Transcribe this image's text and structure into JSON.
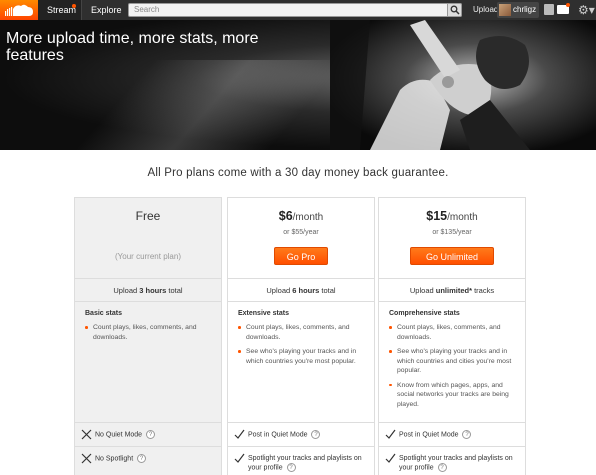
{
  "topbar": {
    "tabs": [
      {
        "label": "Stream"
      },
      {
        "label": "Explore"
      }
    ],
    "search_placeholder": "Search",
    "upload_label": "Upload",
    "username": "chrligz"
  },
  "hero": {
    "title": "More upload time, more stats, more features"
  },
  "guarantee": "All Pro plans come with a 30 day money back guarantee.",
  "plans": {
    "free": {
      "name": "Free",
      "current": "(Your current plan)",
      "upload_prefix": "Upload ",
      "upload_amount": "3 hours",
      "upload_suffix": " total",
      "stats_title": "Basic stats",
      "stats": [
        "Count plays, likes, comments, and downloads."
      ],
      "quiet": "No Quiet Mode",
      "spotlight": "No Spotlight"
    },
    "pro": {
      "price": "$6",
      "period": "/month",
      "yearly": "or $55/year",
      "button": "Go Pro",
      "upload_prefix": "Upload ",
      "upload_amount": "6 hours",
      "upload_suffix": " total",
      "stats_title": "Extensive stats",
      "stats": [
        "Count plays, likes, comments, and downloads.",
        "See who's playing your tracks and in which countries you're most popular."
      ],
      "quiet": "Post in Quiet Mode",
      "spotlight": "Spotlight your tracks and playlists on your profile"
    },
    "unlimited": {
      "price": "$15",
      "period": "/month",
      "yearly": "or $135/year",
      "button": "Go Unlimited",
      "upload_prefix": "Upload ",
      "upload_amount": "unlimited*",
      "upload_suffix": " tracks",
      "stats_title": "Comprehensive stats",
      "stats": [
        "Count plays, likes, comments, and downloads.",
        "See who's playing your tracks and in which countries and cities you're most popular.",
        "Know from which pages, apps, and social networks your tracks are being played."
      ],
      "quiet": "Post in Quiet Mode",
      "spotlight": "Spotlight your tracks and playlists on your profile"
    }
  },
  "help_label": "?",
  "colors": {
    "accent": "#ff5500",
    "topbar": "#2f2f2f"
  }
}
